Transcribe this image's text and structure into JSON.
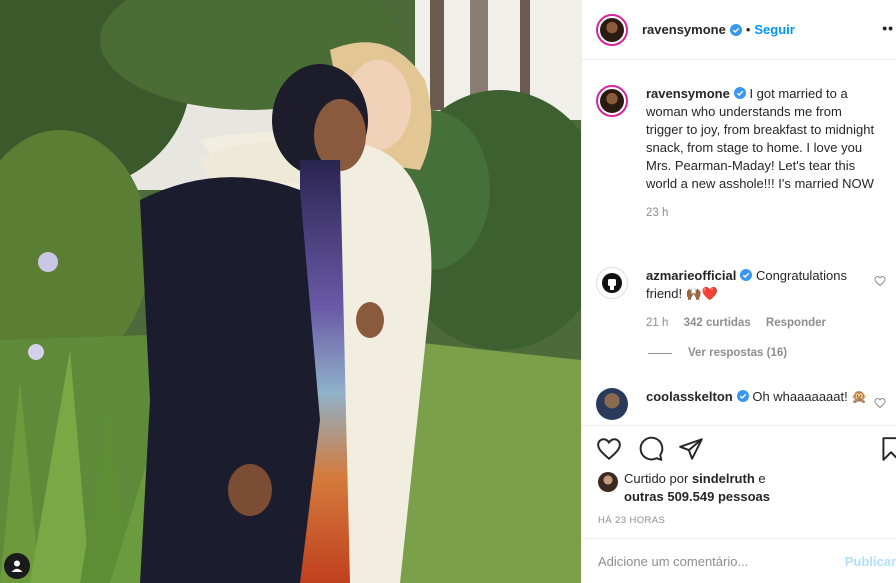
{
  "post": {
    "username": "ravensymone",
    "follow_label": "Seguir",
    "more_label": "••",
    "photo_alt": "",
    "caption": "I got married to a woman who understands me from trigger to joy, from breakfast to midnight snack, from stage to home. I love you Mrs. Pearman-Maday! Let's tear this world a new asshole!!! I's married NOW",
    "caption_time": "23 h"
  },
  "comments": [
    {
      "username": "azmarieofficial",
      "text": "Congratulations friend! 🙌🏾❤️",
      "time": "21 h",
      "likes": "342 curtidas",
      "reply_label": "Responder",
      "view_replies": "Ver respostas (16)"
    },
    {
      "username": "coolasskelton",
      "text": "Oh whaaaaaaat! 🙊"
    }
  ],
  "likes": {
    "prefix": "Curtido por",
    "user": "sindelruth",
    "joiner": "e",
    "others": "outras 509.549 pessoas"
  },
  "timestamp": "HÁ 23 HORAS",
  "add_comment_placeholder": "Adicione um comentário...",
  "publish_label": "Publicar",
  "icons": {
    "verified": "verified-badge-icon",
    "like": "heart-icon",
    "comment": "comment-bubble-icon",
    "share": "paper-plane-icon",
    "save": "bookmark-icon",
    "tag": "user-tag-icon"
  },
  "colors": {
    "accent": "#0095f6",
    "muted": "#8e8e8e",
    "text": "#262626"
  }
}
